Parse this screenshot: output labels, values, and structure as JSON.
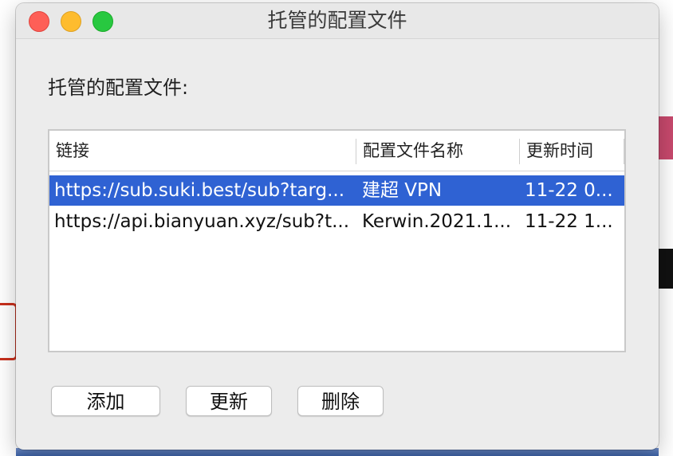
{
  "window": {
    "title": "托管的配置文件",
    "controls": {
      "close_color": "#fe5f57",
      "minimize_color": "#febc2e",
      "maximize_color": "#28c840"
    }
  },
  "section_label": "托管的配置文件:",
  "table": {
    "columns": [
      "链接",
      "配置文件名称",
      "更新时间"
    ],
    "rows": [
      {
        "link": "https://sub.suki.best/sub?targ...",
        "name": "建超 VPN",
        "updated": "11-22 0...",
        "selected": true
      },
      {
        "link": "https://api.bianyuan.xyz/sub?t...",
        "name": "Kerwin.2021.1...",
        "updated": "11-22 1...",
        "selected": false
      }
    ],
    "selection_color": "#2f62d3"
  },
  "buttons": {
    "add": "添加",
    "update": "更新",
    "delete": "删除"
  }
}
